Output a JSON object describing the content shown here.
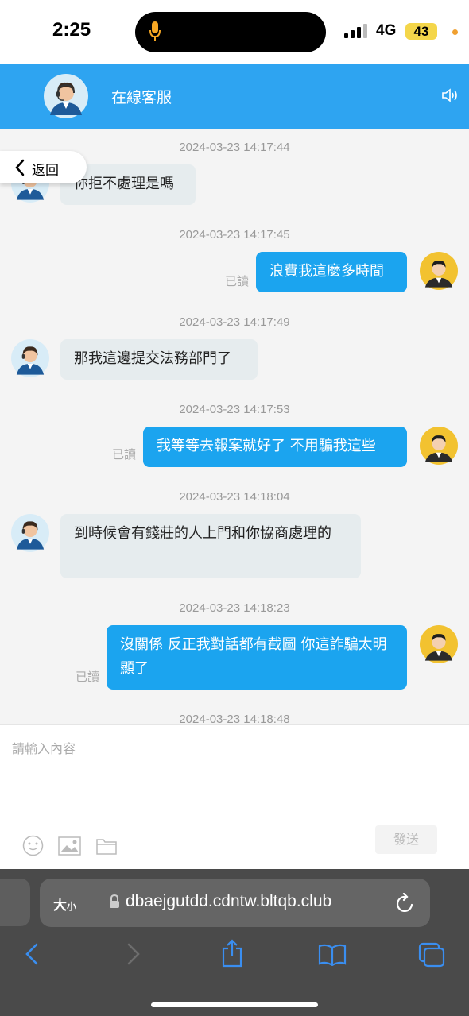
{
  "status_bar": {
    "time": "2:25",
    "network": "4G",
    "battery": "43"
  },
  "header": {
    "title": "在線客服"
  },
  "back_button": {
    "label": "返回"
  },
  "messages": [
    {
      "timestamp": "2024-03-23 14:17:44",
      "side": "in",
      "text": "你拒不處理是嗎",
      "read": ""
    },
    {
      "timestamp": "2024-03-23 14:17:45",
      "side": "out",
      "text": "浪費我這麼多時間",
      "read": "已讀"
    },
    {
      "timestamp": "2024-03-23 14:17:49",
      "side": "in",
      "text": "那我這邊提交法務部門了",
      "read": ""
    },
    {
      "timestamp": "2024-03-23 14:17:53",
      "side": "out",
      "text": "我等等去報案就好了 不用騙我這些",
      "read": "已讀"
    },
    {
      "timestamp": "2024-03-23 14:18:04",
      "side": "in",
      "text": "到時候會有錢莊的人上門和你協商處理的",
      "read": ""
    },
    {
      "timestamp": "2024-03-23 14:18:23",
      "side": "out",
      "text": "沒關係 反正我對話都有截圖 你這詐騙太明顯了",
      "read": "已讀"
    },
    {
      "timestamp": "2024-03-23 14:18:48",
      "side": "",
      "text": "",
      "read": ""
    }
  ],
  "composer": {
    "placeholder": "請輸入內容",
    "send_label": "發送"
  },
  "browser": {
    "text_size_label": "大",
    "text_size_small": "小",
    "url": "dbaejgutdd.cdntw.bltqb.club"
  },
  "colors": {
    "header": "#2ea4f1",
    "outgoing_bubble": "#1ba4ef",
    "incoming_bubble": "#e6ecee"
  }
}
